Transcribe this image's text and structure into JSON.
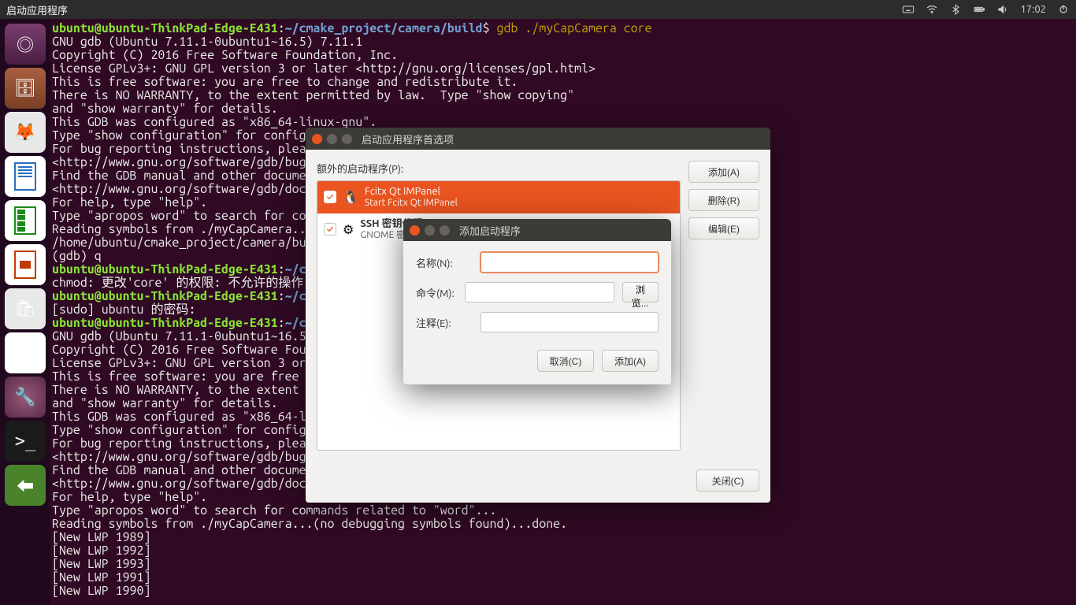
{
  "menubar": {
    "app_title": "启动应用程序",
    "clock": "17:02"
  },
  "launcher": {
    "items": [
      {
        "name": "dash",
        "glyph": "◎"
      },
      {
        "name": "files",
        "glyph": "🗄"
      },
      {
        "name": "firefox",
        "glyph": "🦊"
      },
      {
        "name": "writer",
        "glyph": ""
      },
      {
        "name": "calc",
        "glyph": ""
      },
      {
        "name": "impress",
        "glyph": ""
      },
      {
        "name": "store",
        "glyph": "🛍"
      },
      {
        "name": "amazon",
        "glyph": "a"
      },
      {
        "name": "settings",
        "glyph": "🔧"
      },
      {
        "name": "terminal",
        "glyph": ">_"
      },
      {
        "name": "show-desktop",
        "glyph": "⬅"
      }
    ]
  },
  "terminal": {
    "prompt_user": "ubuntu@ubuntu-ThinkPad-Edge-E431",
    "path1": "~/cmake_project/camera/build",
    "cmd1": "gdb ./myCapCamera core",
    "block1": "GNU gdb (Ubuntu 7.11.1-0ubuntu1~16.5) 7.11.1\nCopyright (C) 2016 Free Software Foundation, Inc.\nLicense GPLv3+: GNU GPL version 3 or later <http://gnu.org/licenses/gpl.html>\nThis is free software: you are free to change and redistribute it.\nThere is NO WARRANTY, to the extent permitted by law.  Type \"show copying\"\nand \"show warranty\" for details.\nThis GDB was configured as \"x86_64-linux-gnu\".\nType \"show configuration\" for configuration details.\nFor bug reporting instructions, please see:\n<http://www.gnu.org/software/gdb/bugs/>.\nFind the GDB manual and other documentation resources online at:\n<http://www.gnu.org/software/gdb/documentation/>.\nFor help, type \"help\".\nType \"apropos word\" to search for commands related to \"word\"...\nReading symbols from ./myCapCamera...(no debugging symbols found)...done.\n/home/ubuntu/cmake_project/camera/build/core: 没有那个文件或目录.\n(gdb) q",
    "path2": "~/cmake_project/camera/build",
    "line2": "chmod: 更改'core' 的权限: 不允许的操作",
    "path3a": "~/cmake_project/camera/build",
    "line3": "[sudo] ubuntu 的密码:",
    "path3b": "~/cmake_project/camera/build",
    "block2": "GNU gdb (Ubuntu 7.11.1-0ubuntu1~16.5) 7.11.1\nCopyright (C) 2016 Free Software Foundation, Inc.\nLicense GPLv3+: GNU GPL version 3 or later <http://gnu.org/licenses/gpl.html>\nThis is free software: you are free to change and redistribute it.\nThere is NO WARRANTY, to the extent permitted by law.  Type \"show copying\"\nand \"show warranty\" for details.\nThis GDB was configured as \"x86_64-linux-gnu\".\nType \"show configuration\" for configuration details.\nFor bug reporting instructions, please see:\n<http://www.gnu.org/software/gdb/bugs/>.\nFind the GDB manual and other documentation resources online at:\n<http://www.gnu.org/software/gdb/documentation/>.\nFor help, type \"help\".\nType \"apropos word\" to search for commands related to \"word\"...\nReading symbols from ./myCapCamera...(no debugging symbols found)...done.\n[New LWP 1989]\n[New LWP 1992]\n[New LWP 1993]\n[New LWP 1991]\n[New LWP 1990]"
  },
  "pref": {
    "title": "启动应用程序首选项",
    "list_label": "额外的启动程序(P):",
    "items": [
      {
        "name": "Fcitx Qt IMPanel",
        "sub": "Start Fcitx Qt IMPanel",
        "icon": "🐧"
      },
      {
        "name": "SSH 密钥代理",
        "sub": "GNOME 密钥环: SSH 代理",
        "icon": "⚙"
      }
    ],
    "buttons": {
      "add": "添加(A)",
      "remove": "删除(R)",
      "edit": "编辑(E)",
      "close": "关闭(C)"
    }
  },
  "add": {
    "title": "添加启动程序",
    "labels": {
      "name": "名称(N):",
      "command": "命令(M):",
      "comment": "注释(E):"
    },
    "values": {
      "name": "",
      "command": "",
      "comment": ""
    },
    "buttons": {
      "browse": "浏览...",
      "cancel": "取消(C)",
      "add": "添加(A)"
    }
  }
}
